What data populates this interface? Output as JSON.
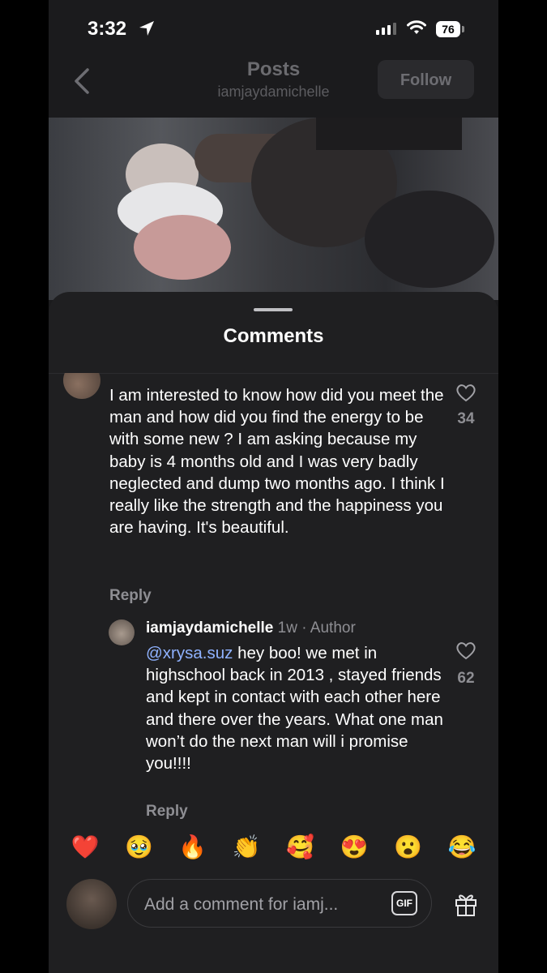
{
  "status_bar": {
    "time": "3:32",
    "battery": "76"
  },
  "header": {
    "title": "Posts",
    "subtitle": "iamjaydamichelle",
    "follow_label": "Follow"
  },
  "sheet": {
    "title": "Comments"
  },
  "comment": {
    "text": "I am interested to know how did you meet the man and how did you find the energy to be with some new ? I am asking because my baby is 4 months old and I was very badly neglected and dump two months ago. I think I really like the strength and the happiness you are having. It's beautiful.",
    "likes": "34",
    "reply_label": "Reply"
  },
  "reply": {
    "username": "iamjaydamichelle",
    "time": "1w",
    "separator": " · ",
    "badge": "Author",
    "mention": "@xrysa.suz",
    "text": " hey boo! we met in highschool back in 2013 , stayed friends and kept in contact with each other here and there over the years. What one man won’t do the next man will i promise you!!!!",
    "likes": "62",
    "reply_label": "Reply"
  },
  "emojis": [
    "❤️",
    "🥹",
    "🔥",
    "👏",
    "🥰",
    "😍",
    "😮",
    "😂"
  ],
  "composer": {
    "placeholder": "Add a comment for iamj...",
    "gif_label": "GIF"
  }
}
